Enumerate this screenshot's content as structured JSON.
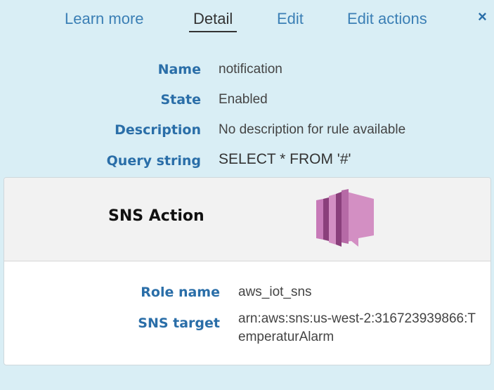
{
  "tabs": {
    "learn_more": "Learn more",
    "detail": "Detail",
    "edit": "Edit",
    "edit_actions": "Edit actions",
    "active": "Detail"
  },
  "close_icon": "×",
  "rule": {
    "name_label": "Name",
    "name_value": "notification",
    "state_label": "State",
    "state_value": "Enabled",
    "description_label": "Description",
    "description_value": "No description for rule available",
    "query_label": "Query string",
    "query_value": "SELECT * FROM '#'"
  },
  "action": {
    "title": "SNS Action",
    "icon": "sns-icon",
    "icon_colors": [
      "#d38fc3",
      "#b66aa6",
      "#8a3f7b",
      "#c77ab8"
    ],
    "role_label": "Role name",
    "role_value": "aws_iot_sns",
    "target_label": "SNS target",
    "target_value": "arn:aws:sns:us-west-2:316723939866:TemperaturAlarm"
  },
  "colors": {
    "background": "#d9eef5",
    "link": "#3b7fb5",
    "label": "#2a6ea8"
  }
}
